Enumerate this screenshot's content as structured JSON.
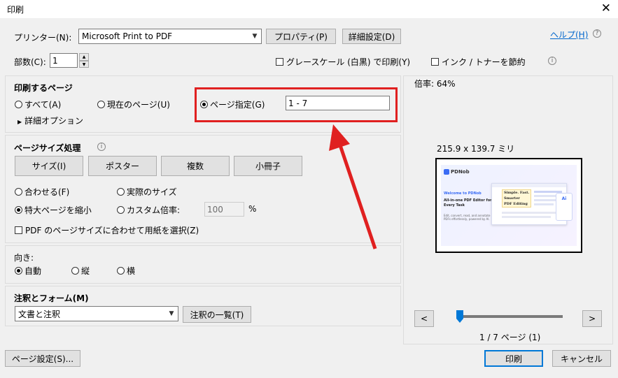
{
  "window": {
    "title": "印刷",
    "close": "✕"
  },
  "printer": {
    "label": "プリンター(N):",
    "value": "Microsoft Print to PDF",
    "properties": "プロパティ(P)",
    "advanced": "詳細設定(D)",
    "help": "ヘルプ(H)"
  },
  "copies": {
    "label": "部数(C):",
    "value": "1"
  },
  "options": {
    "grayscale": "グレースケール (白黒) で印刷(Y)",
    "save_ink": "インク / トナーを節約"
  },
  "pages": {
    "header": "印刷するページ",
    "all": "すべて(A)",
    "current": "現在のページ(U)",
    "specify": "ページ指定(G)",
    "range": "1 - 7",
    "more": "詳細オプション"
  },
  "sizing": {
    "header": "ページサイズ処理",
    "size": "サイズ(I)",
    "poster": "ポスター",
    "multiple": "複数",
    "booklet": "小冊子",
    "fit": "合わせる(F)",
    "actual": "実際のサイズ",
    "shrink": "特大ページを縮小",
    "custom": "カスタム倍率:",
    "custom_value": "100",
    "percent": "%",
    "choose_paper": "PDF のページサイズに合わせて用紙を選択(Z)"
  },
  "orientation": {
    "header": "向き:",
    "auto": "自動",
    "portrait": "縦",
    "landscape": "横"
  },
  "comments": {
    "header": "注釈とフォーム(M)",
    "value": "文書と注釈",
    "summary": "注釈の一覧(T)"
  },
  "preview": {
    "scale": "倍率: 64%",
    "dimensions": "215.9 x 139.7 ミリ",
    "page_indicator": "1 / 7 ページ (1)",
    "prev": "<",
    "next": ">",
    "slider_position": 0,
    "thumb": {
      "brand": "PDNob",
      "welcome": "Welcome to PDNob",
      "headline": "All-in-one PDF Editor for Every Task",
      "body": "Edit, convert, read, and annotate PDFs effortlessly, powered by AI.",
      "card1": "Simple. Fast.",
      "card2": "Smarter",
      "card3": "PDF Editing",
      "badge": "Ai"
    }
  },
  "footer": {
    "page_setup": "ページ設定(S)...",
    "print": "印刷",
    "cancel": "キャンセル"
  },
  "colors": {
    "highlight": "#e02020",
    "accent": "#0078d7",
    "link": "#0066cc"
  }
}
